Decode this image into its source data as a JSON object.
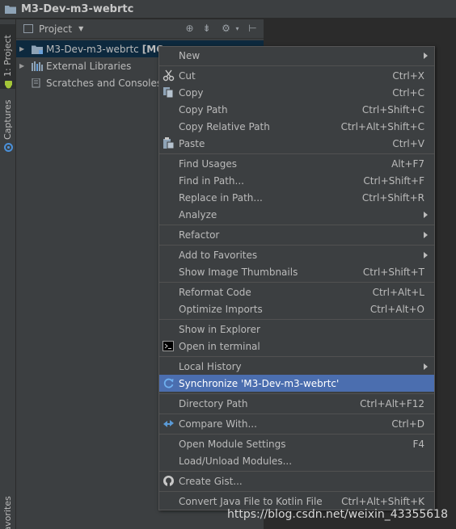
{
  "window": {
    "title": "M3-Dev-m3-webrtc"
  },
  "toolstrip": {
    "tabs": [
      {
        "label": "1: Project",
        "active": true
      },
      {
        "label": "Captures",
        "active": false
      },
      {
        "label": "Favorites",
        "active": false
      }
    ]
  },
  "project_panel": {
    "title": "Project",
    "tree": [
      {
        "label": "M3-Dev-m3-webrtc",
        "suffix": "[MO",
        "icon": "module-folder-icon",
        "selected": true,
        "expandable": true
      },
      {
        "label": "External Libraries",
        "icon": "libraries-icon",
        "selected": false,
        "expandable": true
      },
      {
        "label": "Scratches and Consoles",
        "icon": "scratches-icon",
        "selected": false,
        "expandable": false
      }
    ]
  },
  "context_menu": {
    "groups": [
      [
        {
          "label": "New",
          "shortcut": "",
          "submenu": true,
          "icon": ""
        }
      ],
      [
        {
          "label": "Cut",
          "shortcut": "Ctrl+X",
          "submenu": false,
          "icon": "scissors-icon"
        },
        {
          "label": "Copy",
          "shortcut": "Ctrl+C",
          "submenu": false,
          "icon": "copy-icon"
        },
        {
          "label": "Copy Path",
          "shortcut": "Ctrl+Shift+C",
          "submenu": false,
          "icon": ""
        },
        {
          "label": "Copy Relative Path",
          "shortcut": "Ctrl+Alt+Shift+C",
          "submenu": false,
          "icon": ""
        },
        {
          "label": "Paste",
          "shortcut": "Ctrl+V",
          "submenu": false,
          "icon": "paste-icon"
        }
      ],
      [
        {
          "label": "Find Usages",
          "shortcut": "Alt+F7",
          "submenu": false,
          "icon": ""
        },
        {
          "label": "Find in Path...",
          "shortcut": "Ctrl+Shift+F",
          "submenu": false,
          "icon": ""
        },
        {
          "label": "Replace in Path...",
          "shortcut": "Ctrl+Shift+R",
          "submenu": false,
          "icon": ""
        },
        {
          "label": "Analyze",
          "shortcut": "",
          "submenu": true,
          "icon": ""
        }
      ],
      [
        {
          "label": "Refactor",
          "shortcut": "",
          "submenu": true,
          "icon": ""
        }
      ],
      [
        {
          "label": "Add to Favorites",
          "shortcut": "",
          "submenu": true,
          "icon": ""
        },
        {
          "label": "Show Image Thumbnails",
          "shortcut": "Ctrl+Shift+T",
          "submenu": false,
          "icon": ""
        }
      ],
      [
        {
          "label": "Reformat Code",
          "shortcut": "Ctrl+Alt+L",
          "submenu": false,
          "icon": ""
        },
        {
          "label": "Optimize Imports",
          "shortcut": "Ctrl+Alt+O",
          "submenu": false,
          "icon": ""
        }
      ],
      [
        {
          "label": "Show in Explorer",
          "shortcut": "",
          "submenu": false,
          "icon": ""
        },
        {
          "label": "Open in terminal",
          "shortcut": "",
          "submenu": false,
          "icon": "terminal-icon"
        }
      ],
      [
        {
          "label": "Local History",
          "shortcut": "",
          "submenu": true,
          "icon": ""
        },
        {
          "label": "Synchronize 'M3-Dev-m3-webrtc'",
          "shortcut": "",
          "submenu": false,
          "icon": "sync-icon",
          "highlighted": true
        }
      ],
      [
        {
          "label": "Directory Path",
          "shortcut": "Ctrl+Alt+F12",
          "submenu": false,
          "icon": ""
        }
      ],
      [
        {
          "label": "Compare With...",
          "shortcut": "Ctrl+D",
          "submenu": false,
          "icon": "compare-icon"
        }
      ],
      [
        {
          "label": "Open Module Settings",
          "shortcut": "F4",
          "submenu": false,
          "icon": ""
        },
        {
          "label": "Load/Unload Modules...",
          "shortcut": "",
          "submenu": false,
          "icon": ""
        }
      ],
      [
        {
          "label": "Create Gist...",
          "shortcut": "",
          "submenu": false,
          "icon": "github-icon"
        }
      ],
      [
        {
          "label": "Convert Java File to Kotlin File",
          "shortcut": "Ctrl+Alt+Shift+K",
          "submenu": false,
          "icon": ""
        }
      ]
    ]
  },
  "watermark": {
    "text": "https://blog.csdn.net/weixin_43355618"
  },
  "colors": {
    "highlight": "#4b6eaf",
    "background": "#3c3f41",
    "editor": "#2b2b2b"
  }
}
